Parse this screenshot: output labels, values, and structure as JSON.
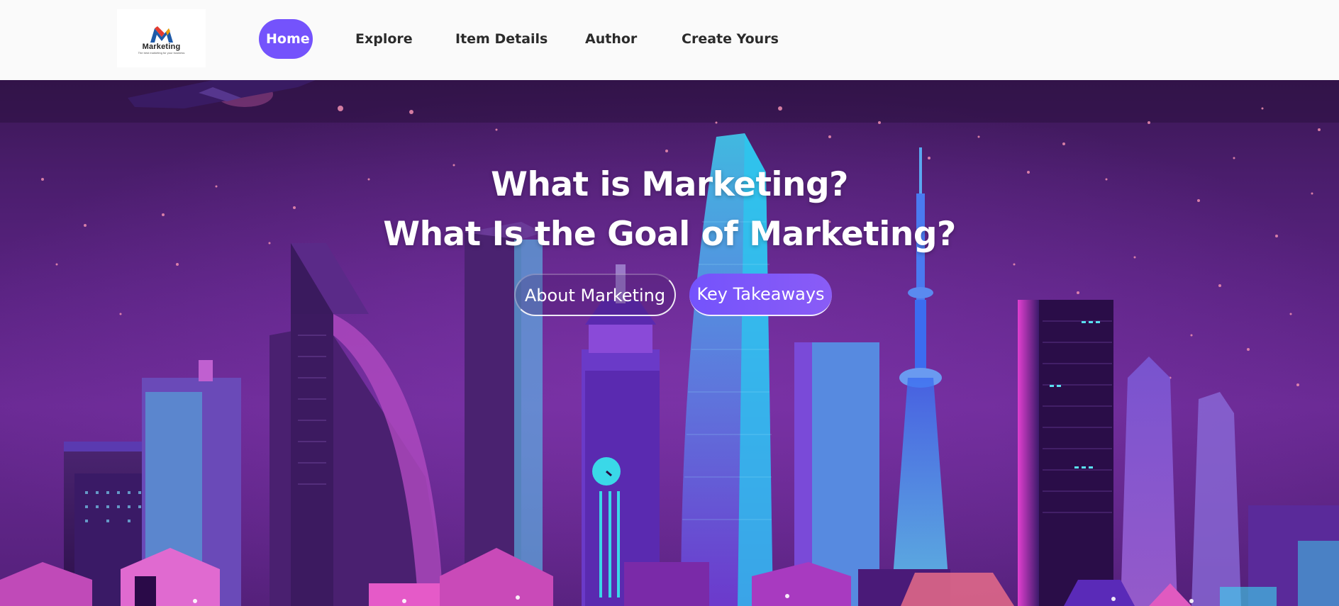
{
  "logo": {
    "text": "Marketing",
    "tagline": "The best marketing for your business"
  },
  "nav": {
    "items": [
      {
        "label": "Home",
        "active": true
      },
      {
        "label": "Explore"
      },
      {
        "label": "Item Details"
      },
      {
        "label": "Author"
      },
      {
        "label": "Create Yours"
      }
    ]
  },
  "hero": {
    "title_line1": "What is Marketing?",
    "title_line2": "What Is the Goal of Marketing?",
    "btn_about": "About Marketing",
    "btn_key": "Key Takeaways",
    "background": "neon-city-skyline-illustration"
  },
  "colors": {
    "accent": "#7453fc",
    "header_bg": "#fafafa",
    "text_dark": "#2b2b2b"
  }
}
